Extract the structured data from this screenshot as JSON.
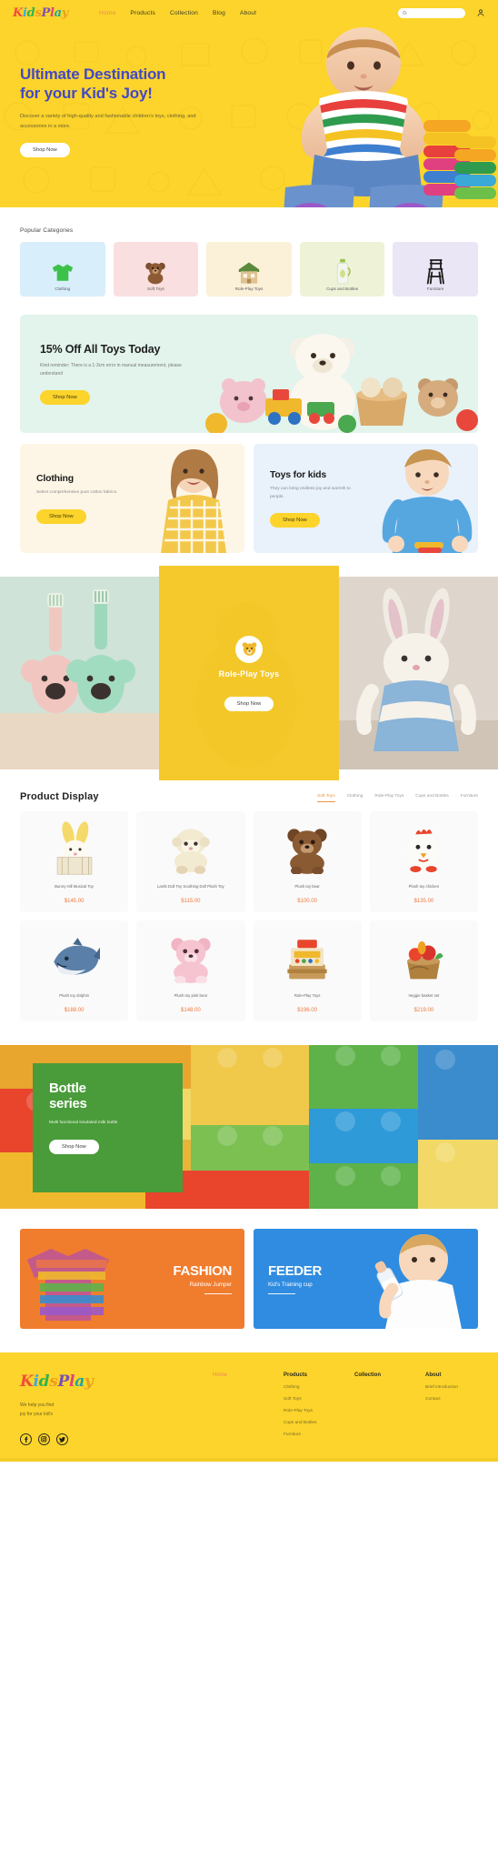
{
  "brand": {
    "name": "KidsPlay",
    "letters": [
      "K",
      "i",
      "d",
      "s",
      "P",
      "l",
      "a",
      "y"
    ]
  },
  "header": {
    "nav": [
      {
        "label": "Home",
        "active": true
      },
      {
        "label": "Products",
        "active": false
      },
      {
        "label": "Collection",
        "active": false
      },
      {
        "label": "Blog",
        "active": false
      },
      {
        "label": "About",
        "active": false
      }
    ],
    "search": {
      "placeholder": "",
      "value": "",
      "icon": "search-icon"
    },
    "account_icon": "user-icon"
  },
  "hero": {
    "title_line1": "Ultimate Destination",
    "title_line2": "for your Kid's Joy!",
    "subtitle": "Discover a variety of high-quality and fashionable children's toys, clothing, and accessories in a store.",
    "cta": "Shop Now",
    "bg_color": "#fcd42b",
    "title_color": "#4348c4"
  },
  "categories": {
    "title": "Popular Categories",
    "items": [
      {
        "label": "Clothing",
        "bg": "#d8eefa",
        "art": "tshirt"
      },
      {
        "label": "Soft Toys",
        "bg": "#fadfe0",
        "art": "bear"
      },
      {
        "label": "Role-Play Toys",
        "bg": "#fbf0d8",
        "art": "house"
      },
      {
        "label": "Cups and Bottles",
        "bg": "#eef3d8",
        "art": "bottle"
      },
      {
        "label": "Furniture",
        "bg": "#eae6f5",
        "art": "chair"
      }
    ]
  },
  "promo": {
    "heading": "15% Off All Toys Today",
    "text": "Kind reminder: There is a 1-3cm error in manual measurement, please understand",
    "cta": "Shop Now",
    "bg": "#e2f4ec"
  },
  "duo": [
    {
      "heading": "Clothing",
      "text": "Select comprehensive pure cotton fabrics.",
      "cta": "Shop Now",
      "bg": "#fdf6e6"
    },
    {
      "heading": "Toys for kids",
      "text": "They can bring endless joy and warmth to people.",
      "cta": "Shop Now",
      "bg": "#e9f1fb"
    }
  ],
  "triptych": {
    "center_heading": "Role-Play Toys",
    "center_cta": "Shop Now",
    "badge_icon": "bear-face-icon",
    "overlay_color": "#f7ca22"
  },
  "products": {
    "title": "Product Display",
    "tabs": [
      {
        "label": "Soft Toys",
        "active": true
      },
      {
        "label": "Clothing",
        "active": false
      },
      {
        "label": "Role-Play Toys",
        "active": false
      },
      {
        "label": "Cups and Bottles",
        "active": false
      },
      {
        "label": "Furniture",
        "active": false
      }
    ],
    "items": [
      {
        "name": "Bunny Hill Musical Toy",
        "price": "$145.00",
        "art": "bunny"
      },
      {
        "name": "Lamb Doll Toy Soothing Doll Plush Toy",
        "price": "$115.00",
        "art": "lamb"
      },
      {
        "name": "Plush toy bear",
        "price": "$100.00",
        "art": "bear"
      },
      {
        "name": "Plush toy chicken",
        "price": "$135.00",
        "art": "chicken"
      },
      {
        "name": "Plush toy dolphin",
        "price": "$188.00",
        "art": "dolphin"
      },
      {
        "name": "Plush toy pink bear",
        "price": "$148.00",
        "art": "pinkbear"
      },
      {
        "name": "Role-Play Toys",
        "price": "$196.00",
        "art": "register"
      },
      {
        "name": "Veggie basket set",
        "price": "$219.00",
        "art": "veggies"
      }
    ],
    "price_color": "#ef7a3d"
  },
  "bottle": {
    "heading_line1": "Bottle",
    "heading_line2": "series",
    "text": "Multi functional insulated milk bottle",
    "cta": "Shop Now",
    "box_color": "#4a9b3a"
  },
  "fashion": [
    {
      "heading": "FASHION",
      "sub": "Rainbow Jumper",
      "bg": "#f07c2e"
    },
    {
      "heading": "FEEDER",
      "sub": "Kid's Training cup",
      "bg": "#2f8ce0"
    }
  ],
  "footer": {
    "tagline_line1": "We help you find",
    "tagline_line2": "joy for your kid's",
    "socials": [
      "facebook-icon",
      "instagram-icon",
      "twitter-icon"
    ],
    "columns": [
      {
        "heading": "Home",
        "is_home": true,
        "links": []
      },
      {
        "heading": "Products",
        "is_home": false,
        "links": [
          "Clothing",
          "Soft Toys",
          "Role-Play Toys",
          "Cups and Bottles",
          "Furniture"
        ]
      },
      {
        "heading": "Collection",
        "is_home": false,
        "links": []
      },
      {
        "heading": "About",
        "is_home": false,
        "links": [
          "Brief introduction",
          "Contact"
        ]
      }
    ]
  }
}
